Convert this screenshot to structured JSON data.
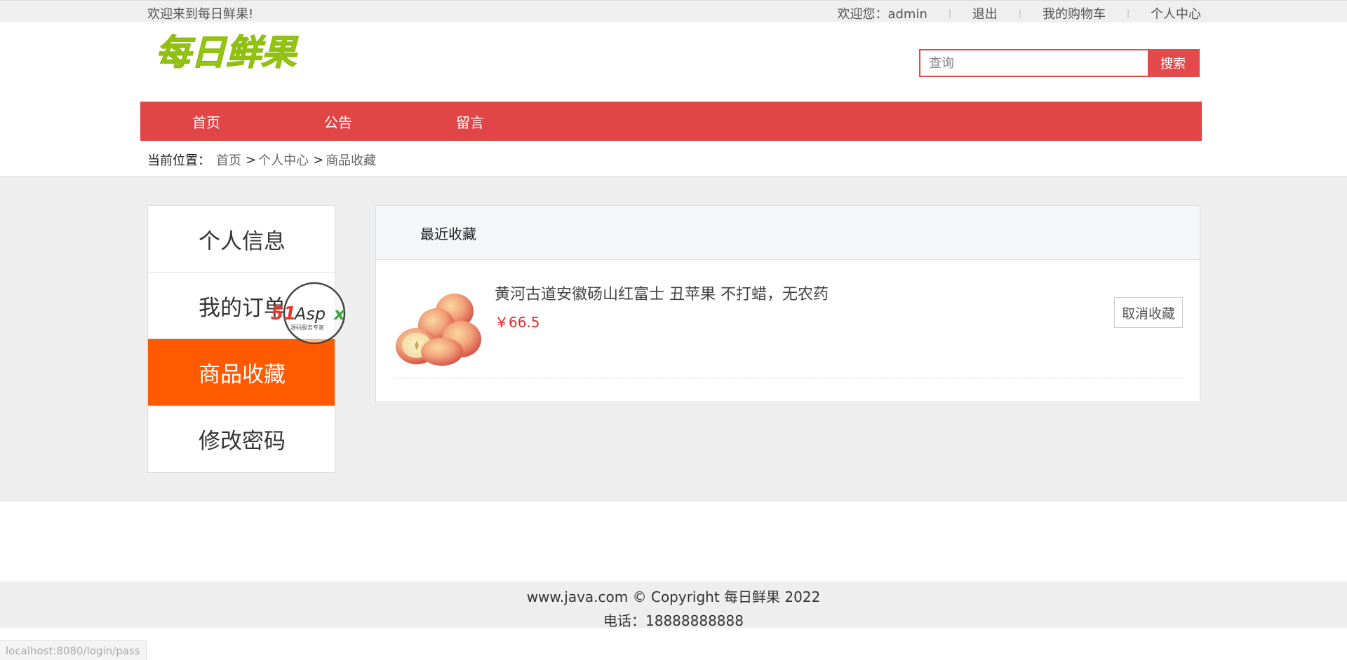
{
  "topbar": {
    "welcome": "欢迎来到每日鲜果!",
    "user_greeting": "欢迎您：admin",
    "logout": "退出",
    "cart": "我的购物车",
    "profile": "个人中心"
  },
  "logo": {
    "text": "每日鲜果",
    "color": "#a6d61a"
  },
  "search": {
    "placeholder": "查询",
    "button": "搜索",
    "accent": "#e34a4b"
  },
  "nav": {
    "items": [
      "首页",
      "公告",
      "留言"
    ],
    "color": "#e04646"
  },
  "breadcrumb": {
    "label": "当前位置：",
    "crumbs": [
      "首页",
      "个人中心",
      "商品收藏"
    ]
  },
  "sidebar": {
    "items": [
      {
        "label": "个人信息",
        "active": false
      },
      {
        "label": "我的订单",
        "active": false
      },
      {
        "label": "商品收藏",
        "active": true
      },
      {
        "label": "修改密码",
        "active": false
      }
    ],
    "active_color": "#ff5a00"
  },
  "watermark": {
    "brand": "51Aspx",
    "tagline": "源码服务专家"
  },
  "favorites": {
    "title": "最近收藏",
    "items": [
      {
        "name": "黄河古道安徽砀山红富士 丑苹果 不打蜡，无农药",
        "price": "￥66.5",
        "image_icon": "apple-image",
        "action": "取消收藏"
      }
    ]
  },
  "footer": {
    "copyright": "www.java.com © Copyright 每日鲜果 2022",
    "phone": "电话：18888888888"
  },
  "status_url": "localhost:8080/login/pass"
}
